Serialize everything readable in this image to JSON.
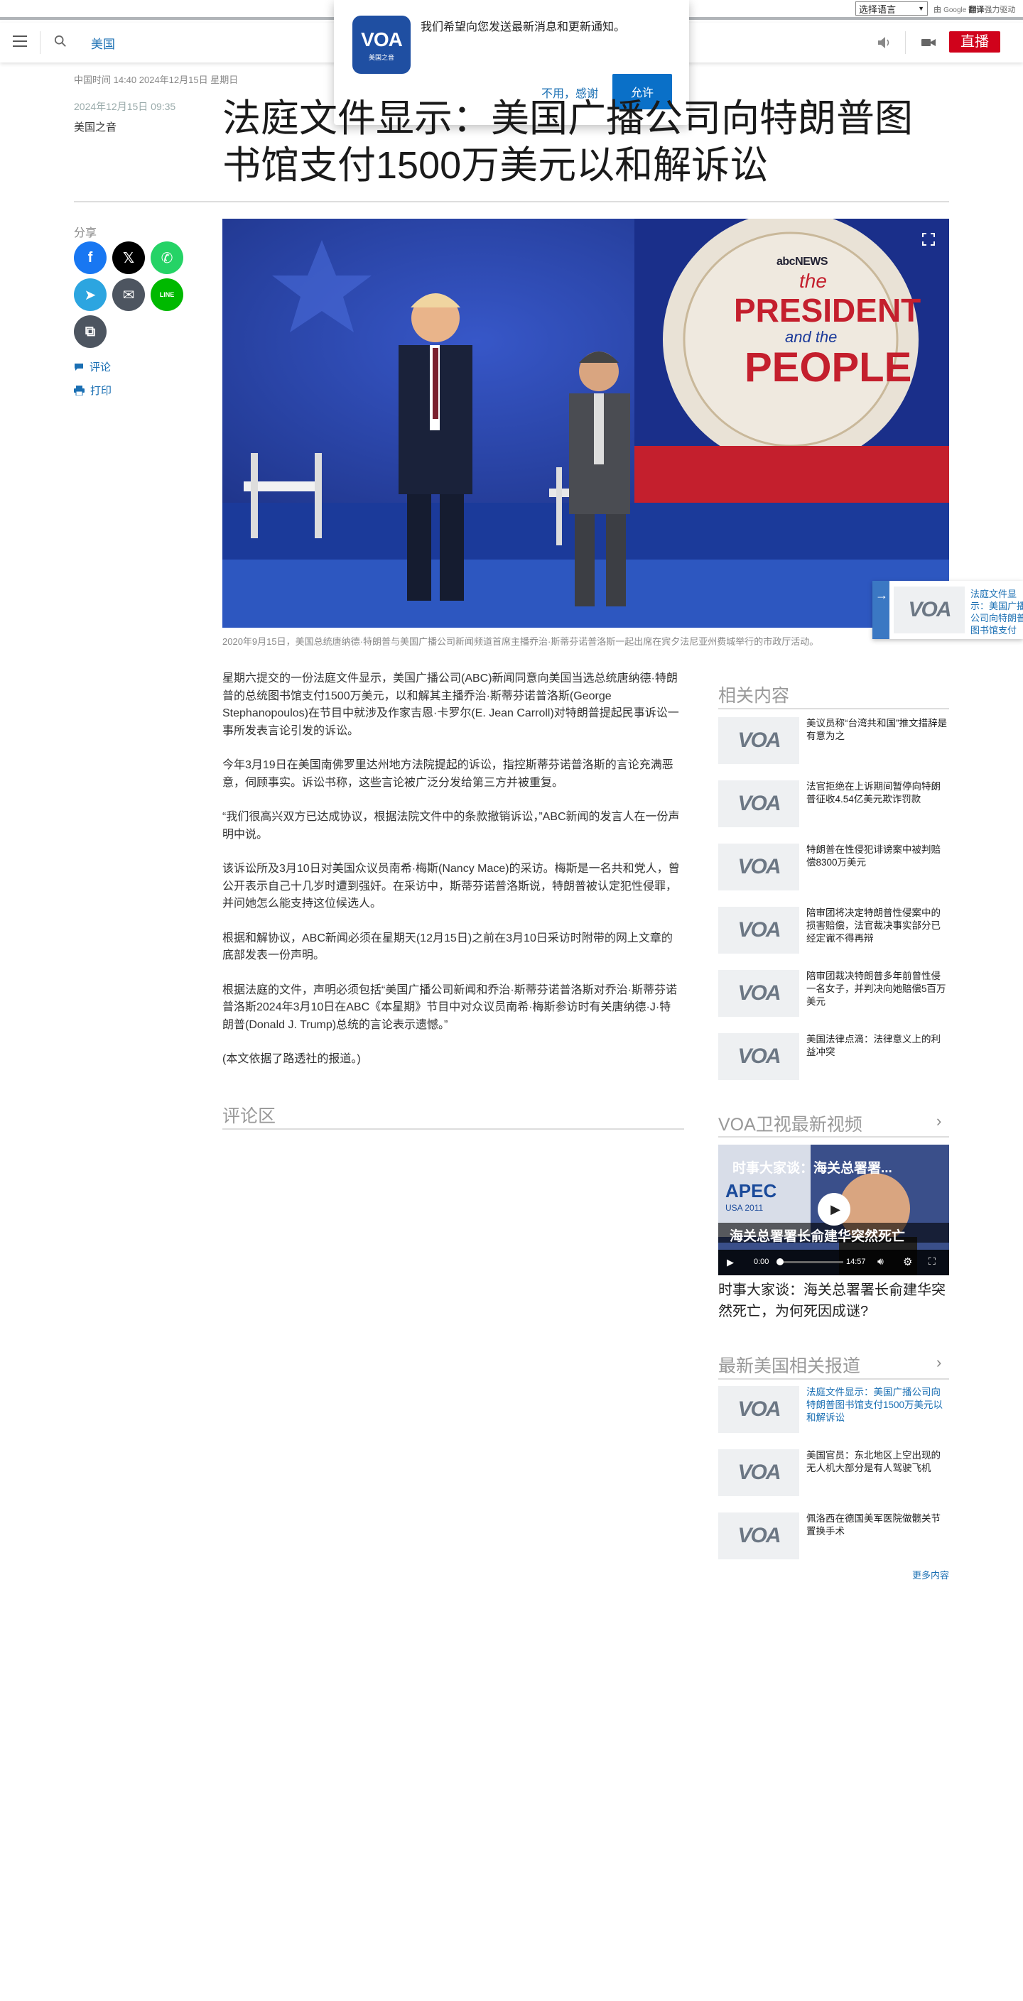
{
  "translate_bar": {
    "select_value": "选择语言",
    "powered_prefix": "由",
    "powered_google": "Google",
    "powered_translate": "翻译",
    "powered_suffix": "强力驱动"
  },
  "header": {
    "menu_icon": "hamburger-menu-icon",
    "search_icon": "search-icon",
    "section": "美国",
    "audio_icon": "speaker-icon",
    "video_icon": "video-camera-icon",
    "live_label": "直播",
    "live_color": "#d0021b"
  },
  "notification": {
    "logo_text": "VOA",
    "logo_sub": "美国之音",
    "message": "我们希望向您发送最新消息和更新通知。",
    "decline_label": "不用，感谢",
    "accept_label": "允许",
    "accept_color": "#0a70c8"
  },
  "article": {
    "dateline": "中国时间 14:40 2024年12月15日 星期日",
    "published": "2024年12月15日 09:35",
    "author": "美国之音",
    "title": "法庭文件显示：美国广播公司向特朗普图书馆支付1500万美元以和解诉讼",
    "share_label": "分享",
    "comment_label": "评论",
    "print_label": "打印",
    "image_badge_news": "abcNEWS",
    "image_banner_the": "the",
    "image_banner_president": "PRESIDENT",
    "image_banner_and": "and the",
    "image_banner_people": "PEOPLE",
    "image_caption": "2020年9月15日，美国总统唐纳德·特朗普与美国广播公司新闻频道首席主播乔治·斯蒂芬诺普洛斯一起出席在宾夕法尼亚州费城举行的市政厅活动。",
    "paragraphs": [
      "星期六提交的一份法庭文件显示，美国广播公司(ABC)新闻同意向美国当选总统唐纳德·特朗普的总统图书馆支付1500万美元，以和解其主播乔治·斯蒂芬诺普洛斯(George Stephanopoulos)在节目中就涉及作家吉恩·卡罗尔(E. Jean Carroll)对特朗普提起民事诉讼一事所发表言论引发的诉讼。",
      "今年3月19日在美国南佛罗里达州地方法院提起的诉讼，指控斯蒂芬诺普洛斯的言论充满恶意，伺顾事实。诉讼书称，这些言论被广泛分发给第三方并被重复。",
      "“我们很高兴双方已达成协议，根据法院文件中的条款撤销诉讼，”ABC新闻的发言人在一份声明中说。",
      "该诉讼所及3月10日对美国众议员南希·梅斯(Nancy Mace)的采访。梅斯是一名共和党人，曾公开表示自己十几岁时遭到强奸。在采访中，斯蒂芬诺普洛斯说，特朗普被认定犯性侵罪，并问她怎么能支持这位候选人。",
      "根据和解协议，ABC新闻必须在星期天(12月15日)之前在3月10日采访时附带的网上文章的底部发表一份声明。",
      "根据法庭的文件，声明必须包括“美国广播公司新闻和乔治·斯蒂芬诺普洛斯对乔治·斯蒂芬诺普洛斯2024年3月10日在ABC《本星期》节目中对众议员南希·梅斯参访时有关唐纳德·J·特朗普(Donald J. Trump)总统的言论表示遗憾。”",
      "(本文依据了路透社的报道。)"
    ],
    "comments_title": "评论区"
  },
  "share_buttons": [
    {
      "name": "facebook-share-button",
      "icon": "facebook-icon",
      "glyph": "f",
      "color": "#1877f2"
    },
    {
      "name": "x-share-button",
      "icon": "x-icon",
      "glyph": "𝕏",
      "color": "#000000"
    },
    {
      "name": "whatsapp-share-button",
      "icon": "whatsapp-icon",
      "glyph": "✆",
      "color": "#25d366"
    },
    {
      "name": "telegram-share-button",
      "icon": "telegram-icon",
      "glyph": "➤",
      "color": "#2ca5e0"
    },
    {
      "name": "email-share-button",
      "icon": "email-icon",
      "glyph": "✉",
      "color": "#4d5560"
    },
    {
      "name": "line-share-button",
      "icon": "line-icon",
      "glyph": "LINE",
      "color": "#00b900"
    },
    {
      "name": "copy-link-button",
      "icon": "copy-icon",
      "glyph": "⧉",
      "color": "#4d5560"
    }
  ],
  "floating_card": {
    "text": "法庭文件显示：美国广播公司向特朗普图书馆支付1500万美元以和解诉讼"
  },
  "related": {
    "heading": "相关内容",
    "items": [
      "美议员称“台湾共和国”推文措辞是有意为之",
      "法官拒绝在上诉期间暂停向特朗普征收4.54亿美元欺诈罚款",
      "特朗普在性侵犯诽谤案中被判赔偿8300万美元",
      "陪审团将决定特朗普性侵案中的损害赔偿，法官裁决事实部分已经定谳不得再辩",
      "陪审团裁决特朗普多年前曾性侵一名女子，并判决向她赔偿5百万美元",
      "美国法律点滴：法律意义上的利益冲突"
    ]
  },
  "video_section": {
    "heading": "VOA卫视最新视频",
    "overlay_title": "时事大家谈：海关总署署...",
    "apec_text": "APEC",
    "apec_sub": "USA 2011",
    "subtitle_text": "海关总署署长俞建华突然死亡",
    "time_current": "0:00",
    "time_total": "14:57",
    "title": "时事大家谈：海关总署署长俞建华突然死亡，为何死因成谜?"
  },
  "latest_section": {
    "heading": "最新美国相关报道",
    "items": [
      "法庭文件显示：美国广播公司向特朗普图书馆支付1500万美元以和解诉讼",
      "美国官员：东北地区上空出现的无人机大部分是有人驾驶飞机",
      "佩洛西在德国美军医院做髋关节置换手术"
    ],
    "more_label": "更多内容"
  }
}
